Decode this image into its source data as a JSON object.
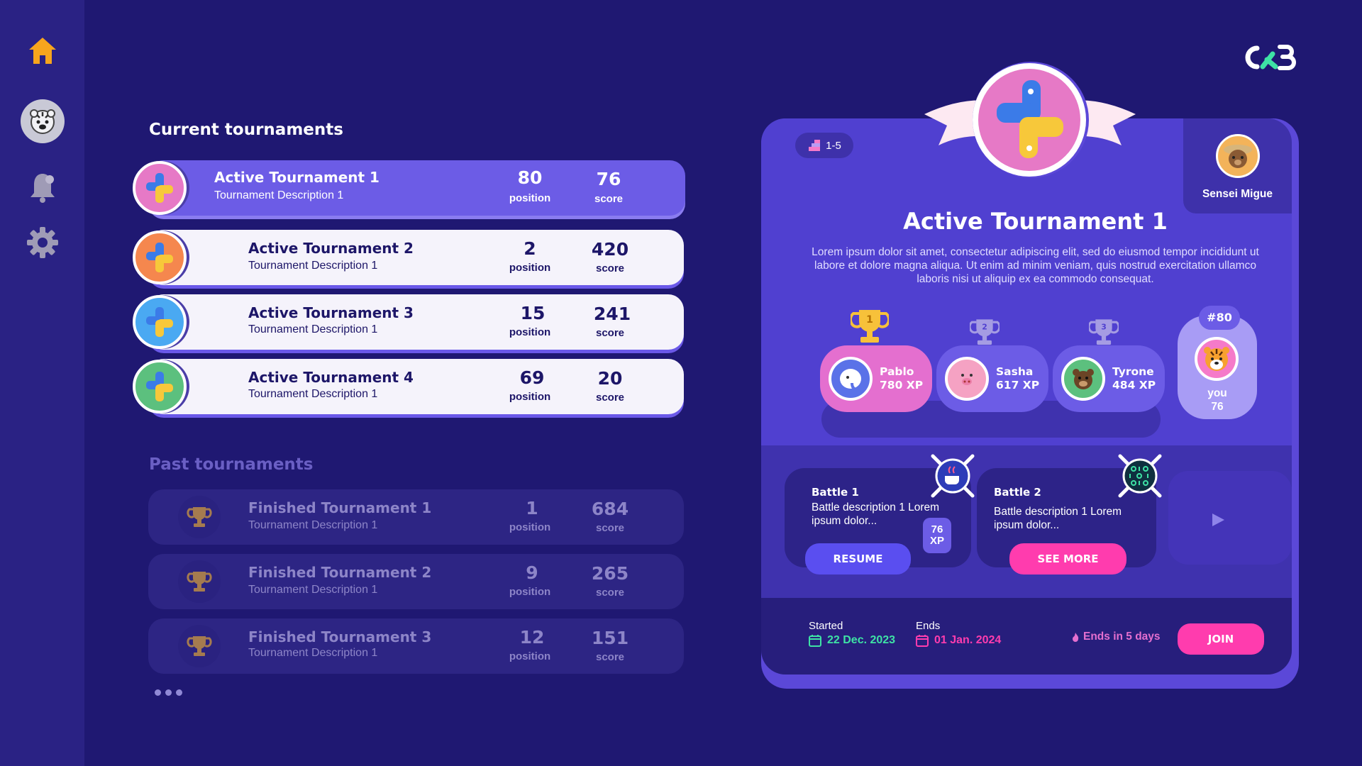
{
  "sidebar": {
    "items": [
      {
        "name": "home-icon",
        "color": "#f7a51d"
      },
      {
        "name": "tiger-avatar"
      },
      {
        "name": "bell-icon"
      },
      {
        "name": "gear-icon"
      }
    ]
  },
  "current": {
    "title": "Current tournaments",
    "items": [
      {
        "title": "Active Tournament 1",
        "desc": "Tournament Description 1",
        "position": "80",
        "position_label": "position",
        "score": "76",
        "score_label": "score",
        "badge_color": "#e679c6"
      },
      {
        "title": "Active Tournament 2",
        "desc": "Tournament Description 1",
        "position": "2",
        "position_label": "position",
        "score": "420",
        "score_label": "score",
        "badge_color": "#f5874e"
      },
      {
        "title": "Active Tournament 3",
        "desc": "Tournament Description 1",
        "position": "15",
        "position_label": "position",
        "score": "241",
        "score_label": "score",
        "badge_color": "#4aa9f2"
      },
      {
        "title": "Active Tournament 4",
        "desc": "Tournament Description 1",
        "position": "69",
        "position_label": "position",
        "score": "20",
        "score_label": "score",
        "badge_color": "#5cc07e"
      }
    ]
  },
  "past": {
    "title": "Past tournaments",
    "items": [
      {
        "title": "Finished Tournament 1",
        "desc": "Tournament Description 1",
        "position": "1",
        "position_label": "position",
        "score": "684",
        "score_label": "score"
      },
      {
        "title": "Finished Tournament 2",
        "desc": "Tournament Description 1",
        "position": "9",
        "position_label": "position",
        "score": "265",
        "score_label": "score"
      },
      {
        "title": "Finished Tournament 3",
        "desc": "Tournament Description 1",
        "position": "12",
        "position_label": "position",
        "score": "151",
        "score_label": "score"
      }
    ]
  },
  "detail": {
    "range": "1-5",
    "creator": "Sensei Migue",
    "title": "Active Tournament 1",
    "description": "Lorem ipsum dolor sit amet, consectetur adipiscing elit, sed do eiusmod tempor incididunt ut labore et dolore magna aliqua. Ut enim ad minim veniam, quis nostrud exercitation ullamco laboris nisi ut aliquip ex ea commodo consequat.",
    "leaderboard": [
      {
        "rank": "1",
        "name": "Pablo",
        "xp": "780 XP",
        "color": "#e46fcf"
      },
      {
        "rank": "2",
        "name": "Sasha",
        "xp": "617 XP",
        "color": "#6c5ce6"
      },
      {
        "rank": "3",
        "name": "Tyrone",
        "xp": "484 XP",
        "color": "#6c5ce6"
      }
    ],
    "you": {
      "rank": "#80",
      "label": "you",
      "score": "76"
    },
    "battles": [
      {
        "title": "Battle 1",
        "desc": "Battle description 1 Lorem ipsum dolor...",
        "xp": "76 XP",
        "button": "RESUME"
      },
      {
        "title": "Battle 2",
        "desc": "Battle description 1 Lorem ipsum dolor...",
        "button": "SEE MORE"
      }
    ],
    "started_label": "Started",
    "started": "22 Dec. 2023",
    "ends_label": "Ends",
    "ends": "01 Jan. 2024",
    "countdown": "Ends in 5 days",
    "join": "JOIN"
  },
  "colors": {
    "background": "#1f1872",
    "accent": "#6c5ce6",
    "pink": "#ff3cae",
    "green": "#3ee2a5"
  }
}
